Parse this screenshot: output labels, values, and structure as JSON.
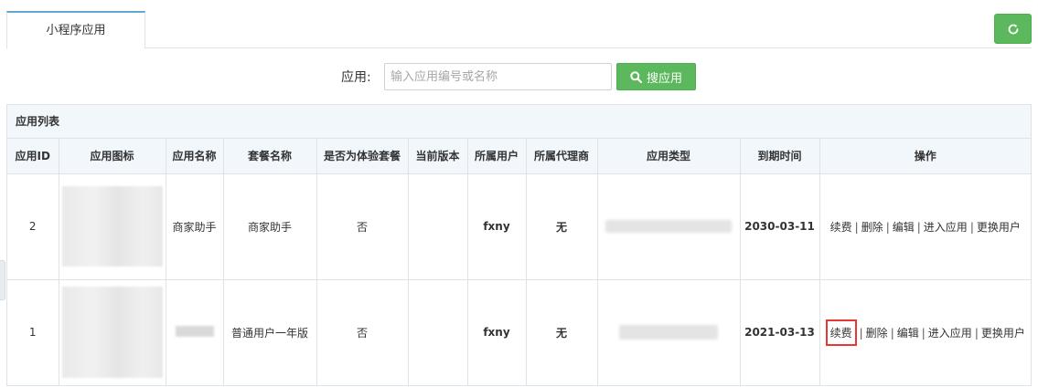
{
  "tabs": [
    {
      "label": "小程序应用",
      "active": true
    }
  ],
  "search": {
    "label": "应用:",
    "placeholder": "输入应用编号或名称",
    "button_label": "搜应用"
  },
  "panel": {
    "title": "应用列表"
  },
  "table": {
    "headers": [
      "应用ID",
      "应用图标",
      "应用名称",
      "套餐名称",
      "是否为体验套餐",
      "当前版本",
      "所属用户",
      "所属代理商",
      "应用类型",
      "到期时间",
      "操作"
    ],
    "rows": [
      {
        "id": "2",
        "name": "商家助手",
        "package": "商家助手",
        "is_trial": "否",
        "version": "",
        "user": "fxny",
        "agent": "无",
        "expire": "2030-03-11"
      },
      {
        "id": "1",
        "name": "",
        "package": "普通用户一年版",
        "is_trial": "否",
        "version": "",
        "user": "fxny",
        "agent": "无",
        "expire": "2021-03-13"
      }
    ],
    "actions": [
      "续费",
      "删除",
      "编辑",
      "进入应用",
      "更换用户"
    ],
    "separator": "|"
  },
  "colors": {
    "primary_green": "#5cb85c",
    "highlight_red": "#e53935",
    "header_bg": "#f2f7fc",
    "tab_accent": "#5fa8d3"
  },
  "icons": {
    "refresh": "refresh-icon",
    "search": "search-icon"
  }
}
